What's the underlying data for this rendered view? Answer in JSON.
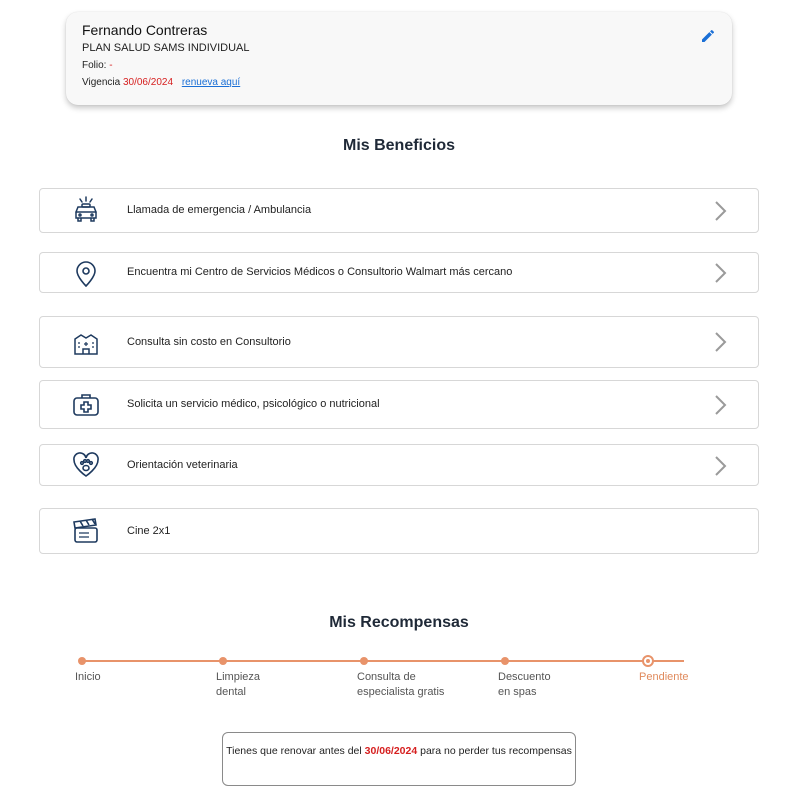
{
  "member": {
    "name": "Fernando Contreras",
    "plan": "PLAN SALUD SAMS INDIVIDUAL",
    "folio_label": "Folio:",
    "folio_value": "-",
    "vigencia_label": "Vigencia",
    "vigencia_date": "30/06/2024",
    "renew_link": "renueva aquí"
  },
  "benefits": {
    "title": "Mis Beneficios",
    "items": [
      {
        "label": "Llamada de emergencia / Ambulancia",
        "icon": "ambulance-icon"
      },
      {
        "label": "Encuentra mi Centro de Servicios Médicos o Consultorio Walmart más cercano",
        "icon": "location-pin-icon"
      },
      {
        "label": "Consulta sin costo en Consultorio",
        "icon": "clinic-building-icon"
      },
      {
        "label": "Solicita un servicio médico, psicológico o nutricional",
        "icon": "medical-kit-icon"
      },
      {
        "label": "Orientación veterinaria",
        "icon": "pet-heart-icon"
      },
      {
        "label": "Cine 2x1",
        "icon": "clapperboard-icon"
      }
    ]
  },
  "rewards": {
    "title": "Mis Recompensas",
    "steps": [
      {
        "line1": "Inicio",
        "line2": ""
      },
      {
        "line1": "Limpieza",
        "line2": "dental"
      },
      {
        "line1": "Consulta de",
        "line2": "especialista gratis"
      },
      {
        "line1": "Descuento",
        "line2": "en spas"
      },
      {
        "line1": "Pendiente",
        "line2": ""
      }
    ],
    "notice_prefix": "Tienes que renovar antes del",
    "notice_date": "30/06/2024",
    "notice_suffix": "para no perder tus recompensas"
  },
  "colors": {
    "accent": "#1a6fd6",
    "alert": "#d61f1f",
    "timeline": "#e8936a",
    "icon_navy": "#1e3a5f"
  }
}
